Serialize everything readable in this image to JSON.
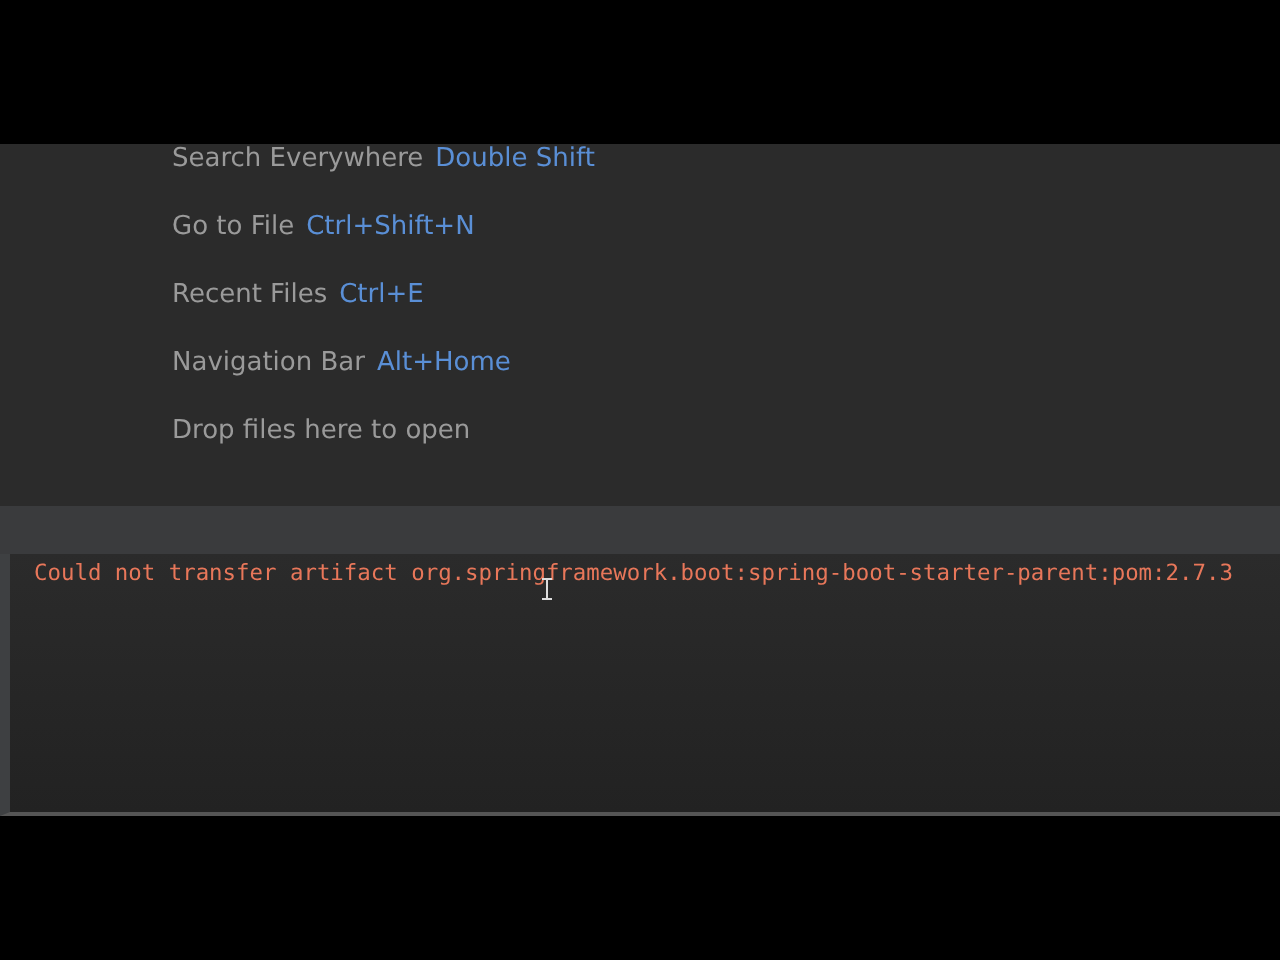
{
  "editor_hints": [
    {
      "label": "Search Everywhere",
      "shortcut": "Double Shift"
    },
    {
      "label": "Go to File",
      "shortcut": "Ctrl+Shift+N"
    },
    {
      "label": "Recent Files",
      "shortcut": "Ctrl+E"
    },
    {
      "label": "Navigation Bar",
      "shortcut": "Alt+Home"
    },
    {
      "label": "Drop files here to open"
    }
  ],
  "console": {
    "lines": [
      {
        "text": "Could not transfer artifact org.springframework.boot:spring-boot-starter-parent:pom:2.7.3",
        "kind": "error"
      }
    ]
  }
}
